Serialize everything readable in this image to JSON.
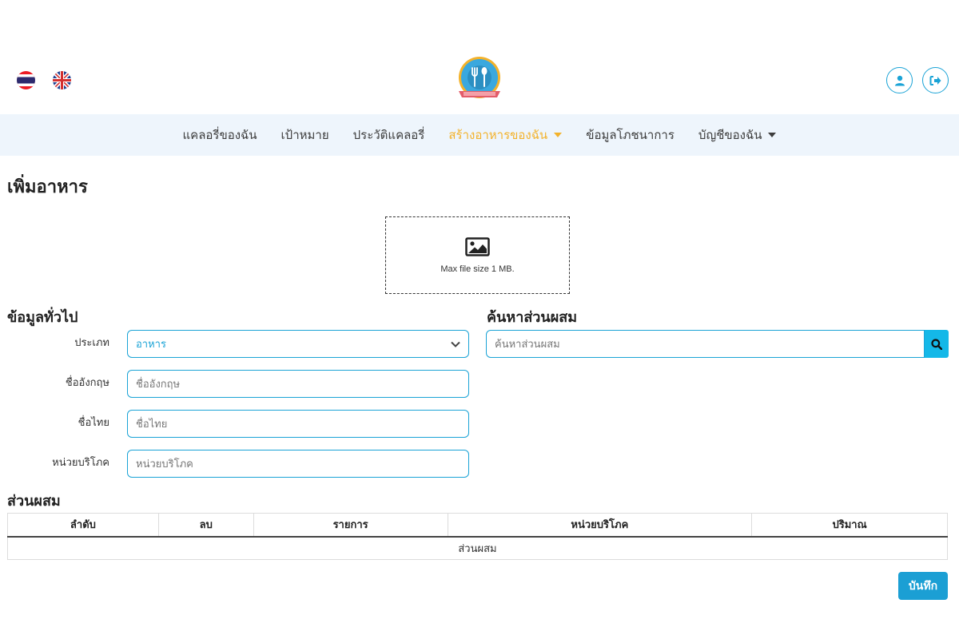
{
  "header": {
    "languages": [
      {
        "code": "th",
        "icon": "thai-flag-icon"
      },
      {
        "code": "en",
        "icon": "uk-flag-icon"
      }
    ],
    "logo_icon": "fork-spoon-plate-logo",
    "user_icon": "user-icon",
    "logout_icon": "logout-icon"
  },
  "nav": {
    "items": [
      {
        "label": "แคลอรี่ของฉัน"
      },
      {
        "label": "เป้าหมาย"
      },
      {
        "label": "ประวัติแคลอรี่"
      },
      {
        "label": "สร้างอาหารของฉัน",
        "active": true,
        "dropdown": true
      },
      {
        "label": "ข้อมูลโภชนาการ"
      },
      {
        "label": "บัญชีของฉัน",
        "dropdown": true
      }
    ]
  },
  "page": {
    "title": "เพิ่มอาหาร"
  },
  "upload": {
    "icon": "image-icon",
    "hint": "Max file size 1 MB."
  },
  "general": {
    "heading": "ข้อมูลทั่วไป",
    "type_label": "ประเภท",
    "type_value": "อาหาร",
    "english_name_label": "ชื่ออังกฤษ",
    "english_name_placeholder": "ชื่ออังกฤษ",
    "thai_name_label": "ชื่อไทย",
    "thai_name_placeholder": "ชื่อไทย",
    "serving_label": "หน่วยบริโภค",
    "serving_placeholder": "หน่วยบริโภค"
  },
  "search": {
    "heading": "ค้นหาส่วนผสม",
    "placeholder": "ค้นหาส่วนผสม",
    "icon": "search-icon"
  },
  "ingredients": {
    "heading": "ส่วนผสม",
    "columns": [
      "ลำดับ",
      "ลบ",
      "รายการ",
      "หน่วยบริโภค",
      "ปริมาณ"
    ],
    "empty_text": "ส่วนผสม"
  },
  "actions": {
    "save_label": "บันทึก"
  },
  "colors": {
    "accent": "#1aa3d6",
    "nav_background": "#eef5fc",
    "active_nav": "#f3b22b",
    "search_button": "#14b8e8",
    "save_button": "#1b9fd4"
  }
}
